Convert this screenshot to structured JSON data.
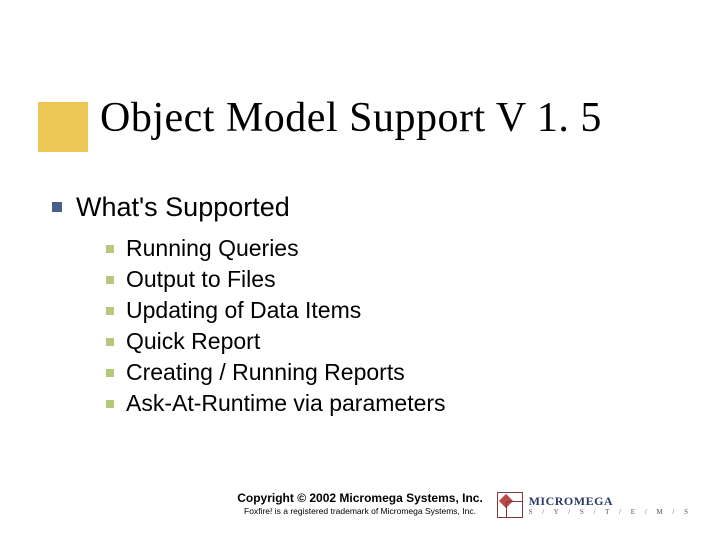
{
  "title": "Object Model Support V 1. 5",
  "section": "What's Supported",
  "items": [
    "Running Queries",
    "Output to Files",
    "Updating of Data Items",
    "Quick Report",
    "Creating / Running Reports",
    "Ask-At-Runtime via parameters"
  ],
  "footer": {
    "copyright": "Copyright © 2002 Micromega Systems, Inc.",
    "trademark": "Foxfire! is a registered trademark of Micromega Systems, Inc."
  },
  "logo": {
    "name": "MICROMEGA",
    "tag": "S / Y / S / T / E / M / S"
  }
}
